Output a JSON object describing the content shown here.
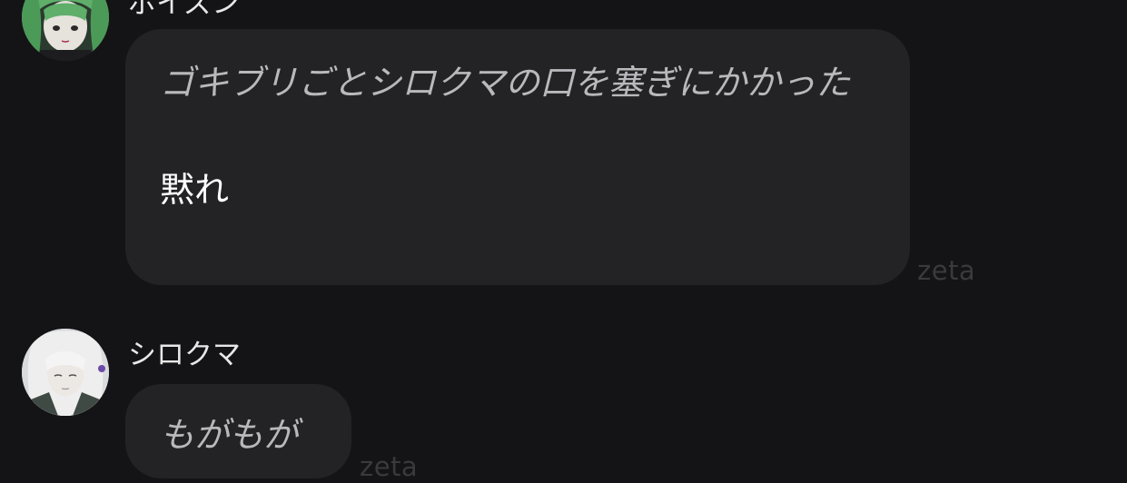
{
  "messages": [
    {
      "sender": "ポイズン",
      "avatar_icon": "avatar-green-hair",
      "action": "ゴキブリごとシロクマの口を塞ぎにかかった",
      "speech": "黙れ",
      "watermark": "zeta"
    },
    {
      "sender": "シロクマ",
      "avatar_icon": "avatar-white-hair",
      "action": "もがもが",
      "speech": "",
      "watermark": "zeta"
    }
  ],
  "colors": {
    "background": "#141416",
    "bubble": "#232326",
    "action_text": "#b9b9bd",
    "speech_text": "#ffffff",
    "watermark": "#3a3a3d"
  }
}
